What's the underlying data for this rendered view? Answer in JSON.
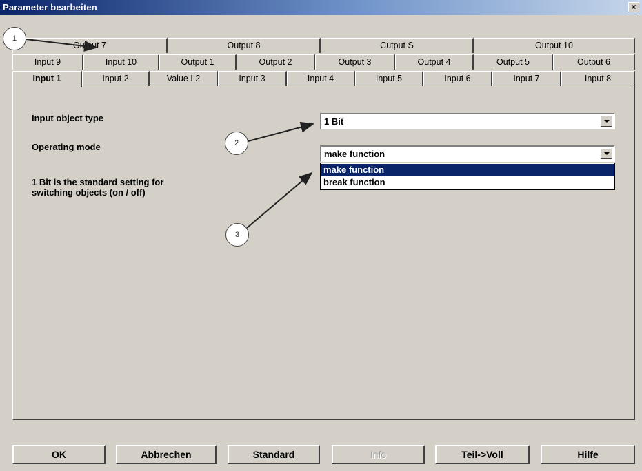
{
  "window": {
    "title": "Parameter bearbeiten",
    "close_label": "×"
  },
  "tabs": {
    "row1": [
      "Output 7",
      "Output 8",
      "Cutput S",
      "Output 10"
    ],
    "row2": [
      "Input 9",
      "Input 10",
      "Output 1",
      "Output 2",
      "Output 3",
      "Output 4",
      "Output 5",
      "Output 6"
    ],
    "row3": [
      "Input 1",
      "Input 2",
      "Value I 2",
      "Input 3",
      "Input 4",
      "Input 5",
      "Input 6",
      "Input 7",
      "Input 8"
    ],
    "active": "Input 1"
  },
  "form": {
    "input_object_type_label": "Input object type",
    "input_object_type_value": "1 Bit",
    "operating_mode_label": "Operating mode",
    "operating_mode_value": "make function",
    "operating_mode_options": [
      "make function",
      "break function"
    ],
    "description_line1": "1 Bit is the standard setting for",
    "description_line2": "switching objects (on / off)"
  },
  "buttons": {
    "ok": "OK",
    "cancel": "Abbrechen",
    "standard": "Standard",
    "info": "Info",
    "partial_full": "Teil->Voll",
    "help": "Hilfe"
  },
  "callouts": [
    "1",
    "2",
    "3"
  ]
}
